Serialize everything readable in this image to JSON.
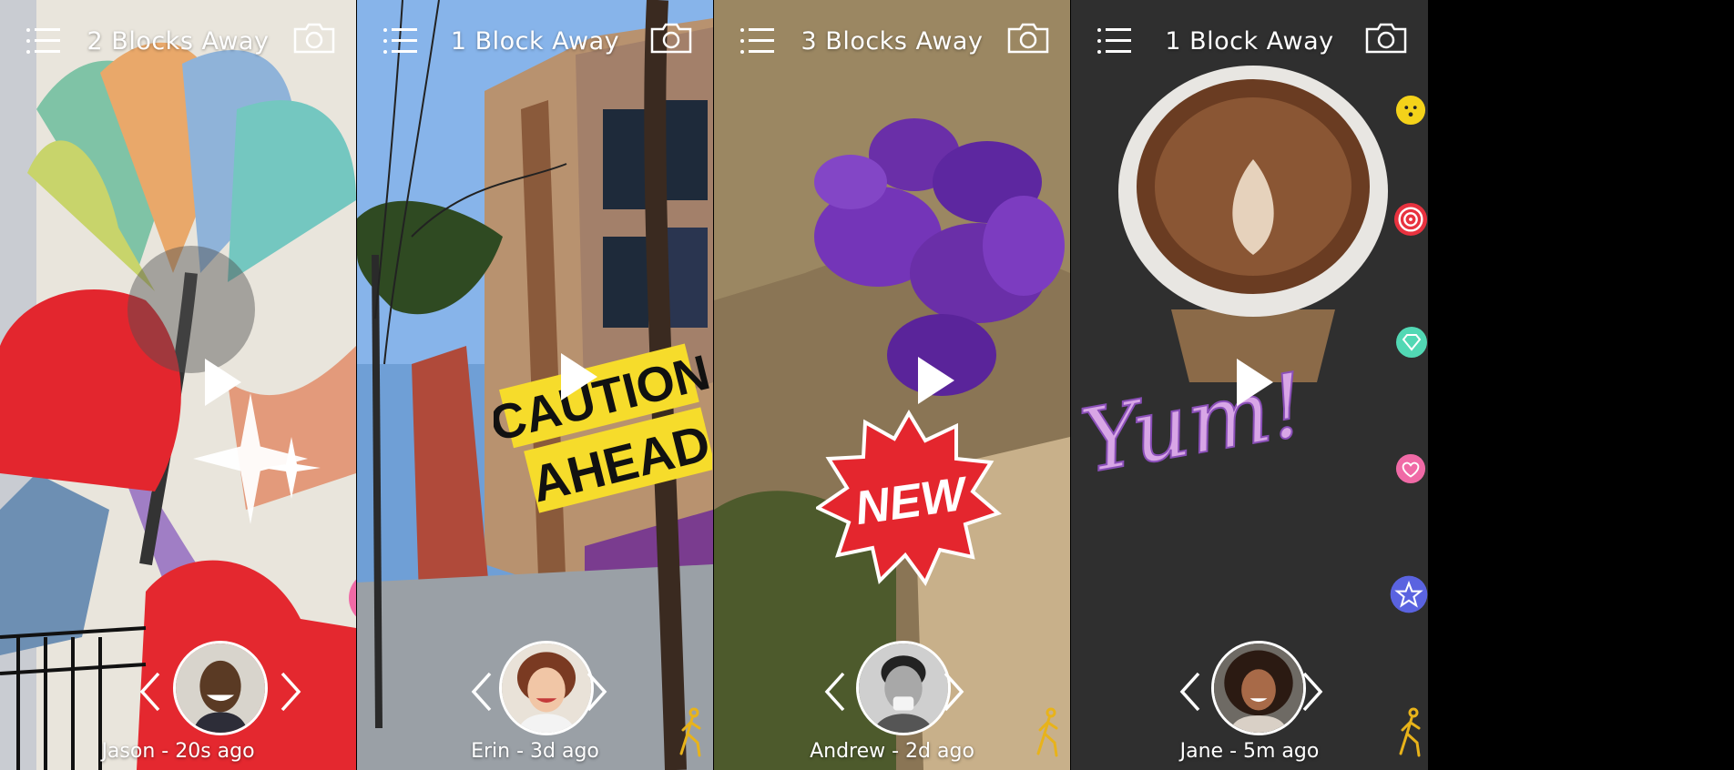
{
  "screens": [
    {
      "title": "2 Blocks Away",
      "caption": "Jason - 20s ago"
    },
    {
      "title": "1 Block Away",
      "caption": "Erin - 3d ago",
      "sticker_line1": "CAUTION",
      "sticker_line2": "AHEAD"
    },
    {
      "title": "3 Blocks Away",
      "caption": "Andrew - 2d ago",
      "sticker": "NEW"
    },
    {
      "title": "1 Block Away",
      "caption": "Jane - 5m ago",
      "sticker": "Yum!"
    }
  ],
  "icons": {
    "menu": "menu-icon",
    "camera": "camera-icon",
    "play": "play-icon",
    "prev": "chevron-left-icon",
    "next": "chevron-right-icon",
    "walker": "walking-person-icon",
    "reactions": [
      "diamond-icon",
      "star-icon",
      "face-icon",
      "target-icon",
      "heart-icon"
    ]
  },
  "colors": {
    "heart": "#f06aa6",
    "diamond": "#52d8b4",
    "star": "#5a63e0",
    "target": "#e8323f",
    "face": "#f4d21a",
    "walker": "#e8b31a"
  }
}
